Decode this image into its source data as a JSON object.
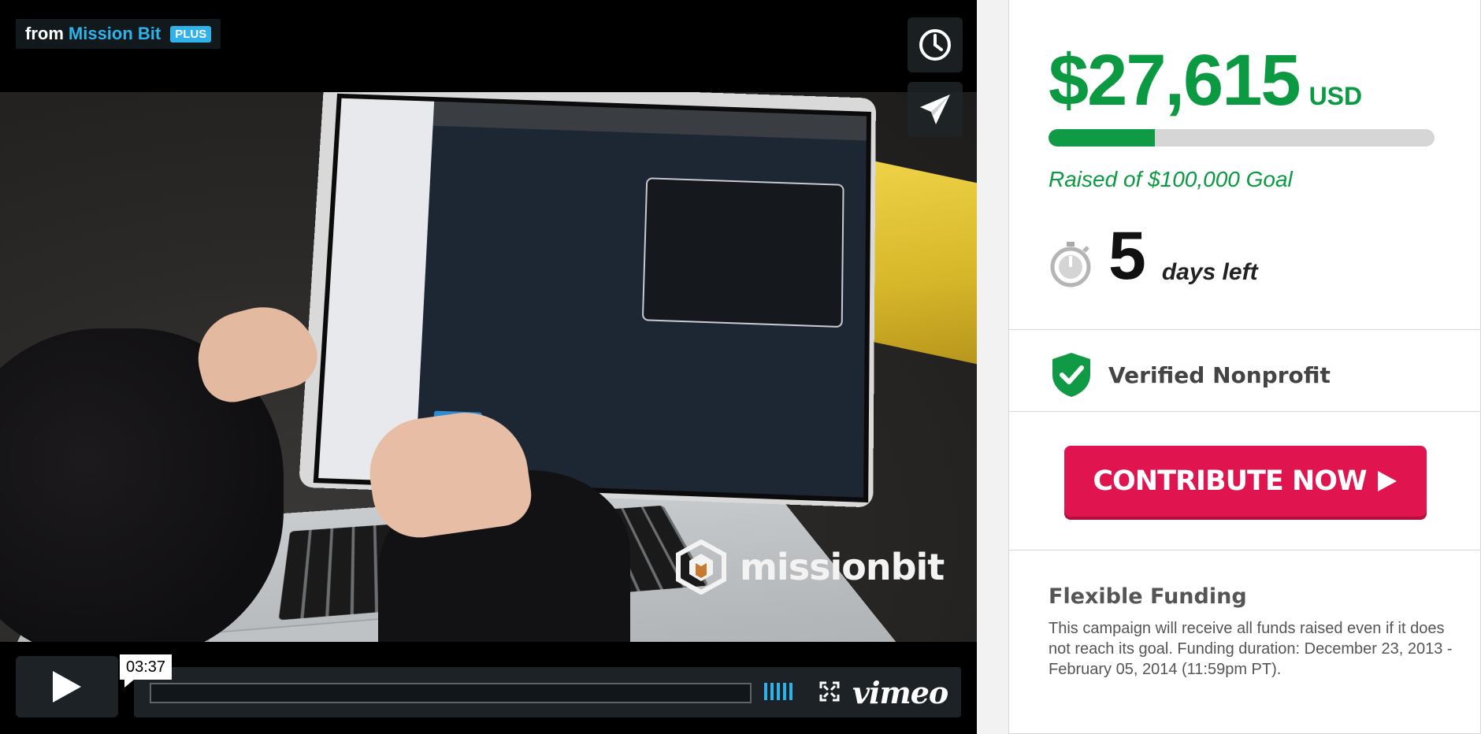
{
  "video": {
    "from_label": "from",
    "owner": "Mission Bit",
    "plus_badge": "PLUS",
    "watermark": "missionbit",
    "time": "03:37",
    "brand": "vimeo",
    "buttons": {
      "watch_later_icon": "clock-icon",
      "share_icon": "paper-plane-icon",
      "play_icon": "play-icon",
      "fullscreen_icon": "fullscreen-icon"
    }
  },
  "campaign": {
    "amount": "$27,615",
    "currency": "USD",
    "progress": 0.27615,
    "raised_label": "Raised of $100,000 Goal",
    "days_number": "5",
    "days_label": "days left",
    "verified": "Verified Nonprofit",
    "cta": "CONTRIBUTE NOW",
    "funding_title": "Flexible Funding",
    "funding_text": "This campaign will receive all funds raised even if it does not reach its goal. Funding duration: December 23, 2013 - February 05, 2014 (11:59pm PT)."
  },
  "colors": {
    "accent_green": "#0b9a42",
    "cta_pink": "#e0144f",
    "vimeo_blue": "#2fb2ea"
  }
}
